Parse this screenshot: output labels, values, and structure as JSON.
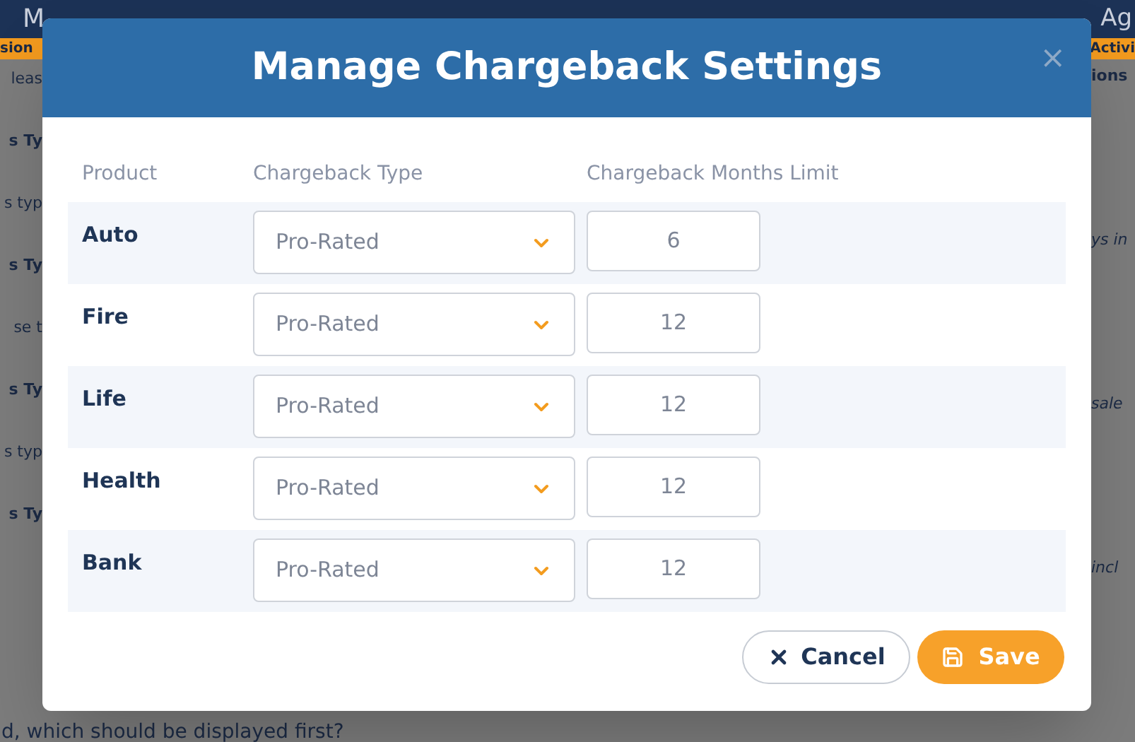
{
  "background": {
    "nav_left": "M",
    "nav_right": "Ag",
    "tab_left": "sion",
    "tab_right": "Activi",
    "left_lines": [
      {
        "text": "leas",
        "kind": "plain"
      },
      {
        "text": "s Ty",
        "kind": "heading"
      },
      {
        "text": "s typ",
        "kind": "plain"
      },
      {
        "text": "s Ty",
        "kind": "heading"
      },
      {
        "text": "se t",
        "kind": "plain"
      },
      {
        "text": "s Ty",
        "kind": "heading"
      },
      {
        "text": "s typ",
        "kind": "plain"
      },
      {
        "text": "s Ty",
        "kind": "heading"
      }
    ],
    "right_lines": [
      {
        "text": "ions",
        "kind": "heading"
      },
      {
        "text": "ys in",
        "kind": "italic"
      },
      {
        "text": "sale",
        "kind": "italic"
      },
      {
        "text": "incl",
        "kind": "italic"
      }
    ],
    "bottom_line": "d, which should be displayed first?"
  },
  "dialog": {
    "title": "Manage Chargeback Settings",
    "close": "×",
    "columns": [
      "Product",
      "Chargeback Type",
      "Chargeback Months Limit"
    ],
    "rows": [
      {
        "product": "Auto",
        "type": "Pro-Rated",
        "limit": "6"
      },
      {
        "product": "Fire",
        "type": "Pro-Rated",
        "limit": "12"
      },
      {
        "product": "Life",
        "type": "Pro-Rated",
        "limit": "12"
      },
      {
        "product": "Health",
        "type": "Pro-Rated",
        "limit": "12"
      },
      {
        "product": "Bank",
        "type": "Pro-Rated",
        "limit": "12"
      }
    ],
    "buttons": [
      {
        "label": "Cancel",
        "kind": "cancel"
      },
      {
        "label": "Save",
        "kind": "save"
      }
    ]
  }
}
